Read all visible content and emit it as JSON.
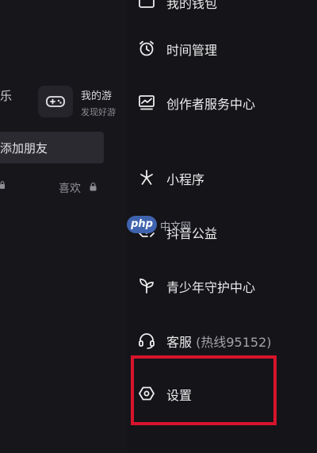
{
  "left_pane": {
    "cut_label": "乐",
    "game_title": "我的游",
    "game_sub": "发现好游",
    "add_friend": "添加朋友",
    "likes": "喜欢"
  },
  "menu": {
    "items": [
      {
        "id": "top-partial",
        "label": "我的钱包",
        "icon": "wallet-icon"
      },
      {
        "id": "time-management",
        "label": "时间管理",
        "icon": "alarm-clock-icon"
      },
      {
        "id": "creator-center",
        "label": "创作者服务中心",
        "icon": "chart-icon"
      },
      {
        "id": "mini-programs",
        "label": "小程序",
        "icon": "sparkle-icon"
      },
      {
        "id": "charity",
        "label": "抖音公益",
        "icon": "hands-heart-icon"
      },
      {
        "id": "youth-protection",
        "label": "青少年守护中心",
        "icon": "sprout-icon"
      },
      {
        "id": "customer-service",
        "label": "客服",
        "hint": "(热线95152)",
        "icon": "headset-icon"
      },
      {
        "id": "settings",
        "label": "设置",
        "icon": "hexagon-gear-icon"
      }
    ]
  },
  "watermark": {
    "logo": "php",
    "text": "中文网"
  },
  "colors": {
    "background": "#141419",
    "highlight": "#D8142C",
    "text": "#EDEDED"
  }
}
